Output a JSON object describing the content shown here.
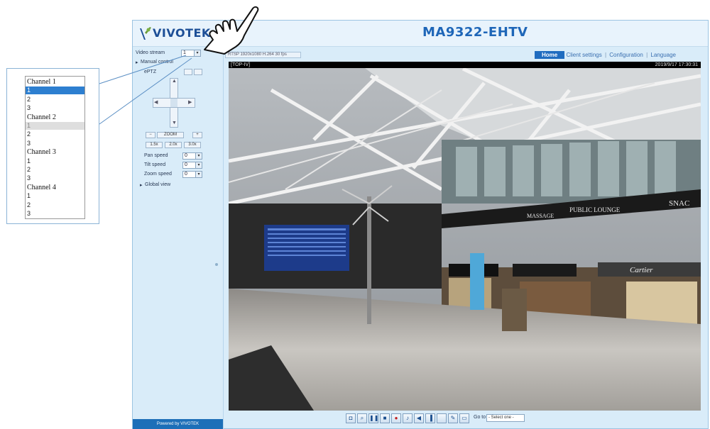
{
  "header": {
    "brand": "VIVOTEK",
    "model": "MA9322-EHTV"
  },
  "nav": {
    "home": "Home",
    "client_settings": "Client settings",
    "configuration": "Configuration",
    "language": "Language",
    "separator": "|"
  },
  "left_panel": {
    "video_stream_label": "Video stream",
    "video_stream_value": "1",
    "manual_control_label": "Manual control",
    "ptz_label": "ePTZ",
    "zoom_out": "−",
    "zoom_mid": "ZOOM",
    "zoom_in": "+",
    "focus_buttons": [
      "1.5x",
      "2.0x",
      "3.0x"
    ],
    "pan_speed_label": "Pan speed",
    "pan_speed_value": "0",
    "tilt_speed_label": "Tilt speed",
    "tilt_speed_value": "0",
    "zoom_speed_label": "Zoom speed",
    "zoom_speed_value": "0",
    "global_view_label": "Global view",
    "footer_text": "Powered by VIVOTEK"
  },
  "protocol_bar": "RTSP  1920x1080  H.264  30 fps",
  "video": {
    "title": "[TOP-IV]",
    "timestamp": "2019/9/17 17:30:31",
    "signs": [
      "PUBLIC LOUNGE",
      "SNAC",
      "MASSAGE",
      "Cartier"
    ]
  },
  "controls": {
    "buttons": [
      {
        "icon": "camera-icon"
      },
      {
        "icon": "zoom-icon"
      },
      {
        "icon": "pause-icon"
      },
      {
        "icon": "stop-icon"
      },
      {
        "icon": "record-icon"
      },
      {
        "icon": "volume-icon"
      },
      {
        "icon": "speaker-icon"
      },
      {
        "icon": "talk-icon"
      },
      {
        "icon": "blank-icon"
      },
      {
        "icon": "mic-icon"
      },
      {
        "icon": "fullscreen-icon"
      }
    ],
    "goto_label": "Go to",
    "goto_value": "- Select one -"
  },
  "dropdown": {
    "items": [
      {
        "text": "Channel 1",
        "type": "head"
      },
      {
        "text": "1",
        "type": "selected"
      },
      {
        "text": "2",
        "type": "item"
      },
      {
        "text": "3",
        "type": "item"
      },
      {
        "text": "Channel 2",
        "type": "head"
      },
      {
        "text": "1",
        "type": "disabled"
      },
      {
        "text": "2",
        "type": "item"
      },
      {
        "text": "3",
        "type": "item"
      },
      {
        "text": "Channel 3",
        "type": "head"
      },
      {
        "text": "1",
        "type": "item"
      },
      {
        "text": "2",
        "type": "item"
      },
      {
        "text": "3",
        "type": "item"
      },
      {
        "text": "Channel 4",
        "type": "head"
      },
      {
        "text": "1",
        "type": "item"
      },
      {
        "text": "2",
        "type": "item"
      },
      {
        "text": "3",
        "type": "item"
      }
    ]
  },
  "colors": {
    "accent": "#1f6cc0",
    "panel_bg": "#d9ecf9",
    "brand": "#1d4f97"
  }
}
